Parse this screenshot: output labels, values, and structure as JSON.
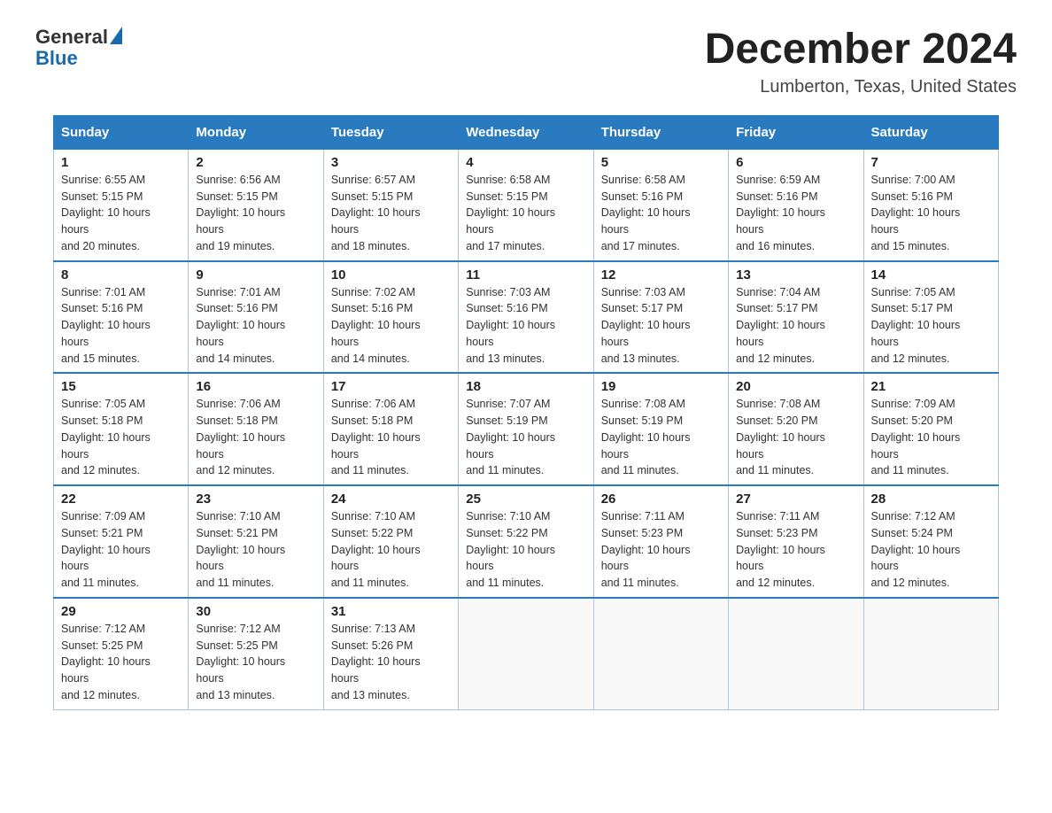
{
  "header": {
    "logo_general": "General",
    "logo_blue": "Blue",
    "title": "December 2024",
    "subtitle": "Lumberton, Texas, United States"
  },
  "days_of_week": [
    "Sunday",
    "Monday",
    "Tuesday",
    "Wednesday",
    "Thursday",
    "Friday",
    "Saturday"
  ],
  "weeks": [
    [
      {
        "day": "1",
        "sunrise": "6:55 AM",
        "sunset": "5:15 PM",
        "daylight": "10 hours and 20 minutes."
      },
      {
        "day": "2",
        "sunrise": "6:56 AM",
        "sunset": "5:15 PM",
        "daylight": "10 hours and 19 minutes."
      },
      {
        "day": "3",
        "sunrise": "6:57 AM",
        "sunset": "5:15 PM",
        "daylight": "10 hours and 18 minutes."
      },
      {
        "day": "4",
        "sunrise": "6:58 AM",
        "sunset": "5:15 PM",
        "daylight": "10 hours and 17 minutes."
      },
      {
        "day": "5",
        "sunrise": "6:58 AM",
        "sunset": "5:16 PM",
        "daylight": "10 hours and 17 minutes."
      },
      {
        "day": "6",
        "sunrise": "6:59 AM",
        "sunset": "5:16 PM",
        "daylight": "10 hours and 16 minutes."
      },
      {
        "day": "7",
        "sunrise": "7:00 AM",
        "sunset": "5:16 PM",
        "daylight": "10 hours and 15 minutes."
      }
    ],
    [
      {
        "day": "8",
        "sunrise": "7:01 AM",
        "sunset": "5:16 PM",
        "daylight": "10 hours and 15 minutes."
      },
      {
        "day": "9",
        "sunrise": "7:01 AM",
        "sunset": "5:16 PM",
        "daylight": "10 hours and 14 minutes."
      },
      {
        "day": "10",
        "sunrise": "7:02 AM",
        "sunset": "5:16 PM",
        "daylight": "10 hours and 14 minutes."
      },
      {
        "day": "11",
        "sunrise": "7:03 AM",
        "sunset": "5:16 PM",
        "daylight": "10 hours and 13 minutes."
      },
      {
        "day": "12",
        "sunrise": "7:03 AM",
        "sunset": "5:17 PM",
        "daylight": "10 hours and 13 minutes."
      },
      {
        "day": "13",
        "sunrise": "7:04 AM",
        "sunset": "5:17 PM",
        "daylight": "10 hours and 12 minutes."
      },
      {
        "day": "14",
        "sunrise": "7:05 AM",
        "sunset": "5:17 PM",
        "daylight": "10 hours and 12 minutes."
      }
    ],
    [
      {
        "day": "15",
        "sunrise": "7:05 AM",
        "sunset": "5:18 PM",
        "daylight": "10 hours and 12 minutes."
      },
      {
        "day": "16",
        "sunrise": "7:06 AM",
        "sunset": "5:18 PM",
        "daylight": "10 hours and 12 minutes."
      },
      {
        "day": "17",
        "sunrise": "7:06 AM",
        "sunset": "5:18 PM",
        "daylight": "10 hours and 11 minutes."
      },
      {
        "day": "18",
        "sunrise": "7:07 AM",
        "sunset": "5:19 PM",
        "daylight": "10 hours and 11 minutes."
      },
      {
        "day": "19",
        "sunrise": "7:08 AM",
        "sunset": "5:19 PM",
        "daylight": "10 hours and 11 minutes."
      },
      {
        "day": "20",
        "sunrise": "7:08 AM",
        "sunset": "5:20 PM",
        "daylight": "10 hours and 11 minutes."
      },
      {
        "day": "21",
        "sunrise": "7:09 AM",
        "sunset": "5:20 PM",
        "daylight": "10 hours and 11 minutes."
      }
    ],
    [
      {
        "day": "22",
        "sunrise": "7:09 AM",
        "sunset": "5:21 PM",
        "daylight": "10 hours and 11 minutes."
      },
      {
        "day": "23",
        "sunrise": "7:10 AM",
        "sunset": "5:21 PM",
        "daylight": "10 hours and 11 minutes."
      },
      {
        "day": "24",
        "sunrise": "7:10 AM",
        "sunset": "5:22 PM",
        "daylight": "10 hours and 11 minutes."
      },
      {
        "day": "25",
        "sunrise": "7:10 AM",
        "sunset": "5:22 PM",
        "daylight": "10 hours and 11 minutes."
      },
      {
        "day": "26",
        "sunrise": "7:11 AM",
        "sunset": "5:23 PM",
        "daylight": "10 hours and 11 minutes."
      },
      {
        "day": "27",
        "sunrise": "7:11 AM",
        "sunset": "5:23 PM",
        "daylight": "10 hours and 12 minutes."
      },
      {
        "day": "28",
        "sunrise": "7:12 AM",
        "sunset": "5:24 PM",
        "daylight": "10 hours and 12 minutes."
      }
    ],
    [
      {
        "day": "29",
        "sunrise": "7:12 AM",
        "sunset": "5:25 PM",
        "daylight": "10 hours and 12 minutes."
      },
      {
        "day": "30",
        "sunrise": "7:12 AM",
        "sunset": "5:25 PM",
        "daylight": "10 hours and 13 minutes."
      },
      {
        "day": "31",
        "sunrise": "7:13 AM",
        "sunset": "5:26 PM",
        "daylight": "10 hours and 13 minutes."
      },
      null,
      null,
      null,
      null
    ]
  ],
  "labels": {
    "sunrise": "Sunrise:",
    "sunset": "Sunset:",
    "daylight": "Daylight:"
  }
}
